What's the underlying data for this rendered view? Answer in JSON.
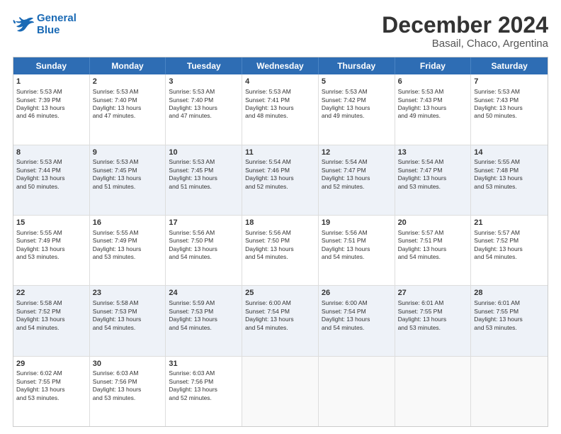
{
  "logo": {
    "line1": "General",
    "line2": "Blue"
  },
  "title": "December 2024",
  "subtitle": "Basail, Chaco, Argentina",
  "columns": [
    "Sunday",
    "Monday",
    "Tuesday",
    "Wednesday",
    "Thursday",
    "Friday",
    "Saturday"
  ],
  "rows": [
    [
      {
        "day": "1",
        "lines": [
          "Sunrise: 5:53 AM",
          "Sunset: 7:39 PM",
          "Daylight: 13 hours",
          "and 46 minutes."
        ]
      },
      {
        "day": "2",
        "lines": [
          "Sunrise: 5:53 AM",
          "Sunset: 7:40 PM",
          "Daylight: 13 hours",
          "and 47 minutes."
        ]
      },
      {
        "day": "3",
        "lines": [
          "Sunrise: 5:53 AM",
          "Sunset: 7:40 PM",
          "Daylight: 13 hours",
          "and 47 minutes."
        ]
      },
      {
        "day": "4",
        "lines": [
          "Sunrise: 5:53 AM",
          "Sunset: 7:41 PM",
          "Daylight: 13 hours",
          "and 48 minutes."
        ]
      },
      {
        "day": "5",
        "lines": [
          "Sunrise: 5:53 AM",
          "Sunset: 7:42 PM",
          "Daylight: 13 hours",
          "and 49 minutes."
        ]
      },
      {
        "day": "6",
        "lines": [
          "Sunrise: 5:53 AM",
          "Sunset: 7:43 PM",
          "Daylight: 13 hours",
          "and 49 minutes."
        ]
      },
      {
        "day": "7",
        "lines": [
          "Sunrise: 5:53 AM",
          "Sunset: 7:43 PM",
          "Daylight: 13 hours",
          "and 50 minutes."
        ]
      }
    ],
    [
      {
        "day": "8",
        "lines": [
          "Sunrise: 5:53 AM",
          "Sunset: 7:44 PM",
          "Daylight: 13 hours",
          "and 50 minutes."
        ]
      },
      {
        "day": "9",
        "lines": [
          "Sunrise: 5:53 AM",
          "Sunset: 7:45 PM",
          "Daylight: 13 hours",
          "and 51 minutes."
        ]
      },
      {
        "day": "10",
        "lines": [
          "Sunrise: 5:53 AM",
          "Sunset: 7:45 PM",
          "Daylight: 13 hours",
          "and 51 minutes."
        ]
      },
      {
        "day": "11",
        "lines": [
          "Sunrise: 5:54 AM",
          "Sunset: 7:46 PM",
          "Daylight: 13 hours",
          "and 52 minutes."
        ]
      },
      {
        "day": "12",
        "lines": [
          "Sunrise: 5:54 AM",
          "Sunset: 7:47 PM",
          "Daylight: 13 hours",
          "and 52 minutes."
        ]
      },
      {
        "day": "13",
        "lines": [
          "Sunrise: 5:54 AM",
          "Sunset: 7:47 PM",
          "Daylight: 13 hours",
          "and 53 minutes."
        ]
      },
      {
        "day": "14",
        "lines": [
          "Sunrise: 5:55 AM",
          "Sunset: 7:48 PM",
          "Daylight: 13 hours",
          "and 53 minutes."
        ]
      }
    ],
    [
      {
        "day": "15",
        "lines": [
          "Sunrise: 5:55 AM",
          "Sunset: 7:49 PM",
          "Daylight: 13 hours",
          "and 53 minutes."
        ]
      },
      {
        "day": "16",
        "lines": [
          "Sunrise: 5:55 AM",
          "Sunset: 7:49 PM",
          "Daylight: 13 hours",
          "and 53 minutes."
        ]
      },
      {
        "day": "17",
        "lines": [
          "Sunrise: 5:56 AM",
          "Sunset: 7:50 PM",
          "Daylight: 13 hours",
          "and 54 minutes."
        ]
      },
      {
        "day": "18",
        "lines": [
          "Sunrise: 5:56 AM",
          "Sunset: 7:50 PM",
          "Daylight: 13 hours",
          "and 54 minutes."
        ]
      },
      {
        "day": "19",
        "lines": [
          "Sunrise: 5:56 AM",
          "Sunset: 7:51 PM",
          "Daylight: 13 hours",
          "and 54 minutes."
        ]
      },
      {
        "day": "20",
        "lines": [
          "Sunrise: 5:57 AM",
          "Sunset: 7:51 PM",
          "Daylight: 13 hours",
          "and 54 minutes."
        ]
      },
      {
        "day": "21",
        "lines": [
          "Sunrise: 5:57 AM",
          "Sunset: 7:52 PM",
          "Daylight: 13 hours",
          "and 54 minutes."
        ]
      }
    ],
    [
      {
        "day": "22",
        "lines": [
          "Sunrise: 5:58 AM",
          "Sunset: 7:52 PM",
          "Daylight: 13 hours",
          "and 54 minutes."
        ]
      },
      {
        "day": "23",
        "lines": [
          "Sunrise: 5:58 AM",
          "Sunset: 7:53 PM",
          "Daylight: 13 hours",
          "and 54 minutes."
        ]
      },
      {
        "day": "24",
        "lines": [
          "Sunrise: 5:59 AM",
          "Sunset: 7:53 PM",
          "Daylight: 13 hours",
          "and 54 minutes."
        ]
      },
      {
        "day": "25",
        "lines": [
          "Sunrise: 6:00 AM",
          "Sunset: 7:54 PM",
          "Daylight: 13 hours",
          "and 54 minutes."
        ]
      },
      {
        "day": "26",
        "lines": [
          "Sunrise: 6:00 AM",
          "Sunset: 7:54 PM",
          "Daylight: 13 hours",
          "and 54 minutes."
        ]
      },
      {
        "day": "27",
        "lines": [
          "Sunrise: 6:01 AM",
          "Sunset: 7:55 PM",
          "Daylight: 13 hours",
          "and 53 minutes."
        ]
      },
      {
        "day": "28",
        "lines": [
          "Sunrise: 6:01 AM",
          "Sunset: 7:55 PM",
          "Daylight: 13 hours",
          "and 53 minutes."
        ]
      }
    ],
    [
      {
        "day": "29",
        "lines": [
          "Sunrise: 6:02 AM",
          "Sunset: 7:55 PM",
          "Daylight: 13 hours",
          "and 53 minutes."
        ]
      },
      {
        "day": "30",
        "lines": [
          "Sunrise: 6:03 AM",
          "Sunset: 7:56 PM",
          "Daylight: 13 hours",
          "and 53 minutes."
        ]
      },
      {
        "day": "31",
        "lines": [
          "Sunrise: 6:03 AM",
          "Sunset: 7:56 PM",
          "Daylight: 13 hours",
          "and 52 minutes."
        ]
      },
      {
        "day": "",
        "lines": []
      },
      {
        "day": "",
        "lines": []
      },
      {
        "day": "",
        "lines": []
      },
      {
        "day": "",
        "lines": []
      }
    ]
  ]
}
